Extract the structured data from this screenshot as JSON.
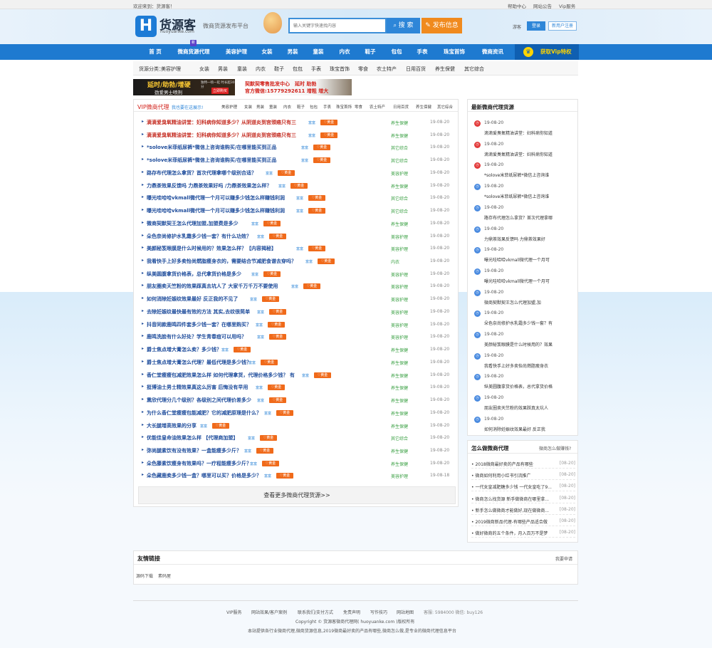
{
  "topbar": {
    "welcome": "欢迎来到：货源客！",
    "help": "帮助中心",
    "announce": "网站公告",
    "vip": "Vip服务"
  },
  "header": {
    "logo_char": "H",
    "logo_name": "货源客",
    "logo_domain": "huoyuanke.com",
    "slogan": "微商货源发布平台",
    "search_placeholder": "输入关键字快速找内容",
    "search_btn": "搜 索",
    "publish_btn": "发布信息",
    "guest": "游客",
    "login": "登录",
    "register": "新用户注册"
  },
  "nav": {
    "items": [
      "首 页",
      "微商货源代理",
      "美容护理",
      "女装",
      "男装",
      "童装",
      "内衣",
      "鞋子",
      "包包",
      "手表",
      "珠宝首饰",
      "微商资讯"
    ],
    "new_badge": "新",
    "vip": "获取Vip特权"
  },
  "categories": {
    "label": "货源分类：",
    "items": [
      "美容护理",
      "女装",
      "男装",
      "童装",
      "内衣",
      "鞋子",
      "包包",
      "手表",
      "珠宝首饰",
      "零食",
      "农土特产",
      "日用百货",
      "养生保健",
      "其它综合"
    ]
  },
  "ads": {
    "ad1_title": "延时/助勃/增硬",
    "ad1_sub": "劲爱男士喷剂",
    "ad1_note": "独特一喷一延 时长超30分",
    "ad1_btn": "立即购买",
    "ad2_line1": "契默契零售批发中心　延时 助勃",
    "ad2_line2": "官方微信:15779292611 增粗 增大"
  },
  "main": {
    "title": "VIP微商代理",
    "subtitle": "我也要在这展示!",
    "tabs": [
      "美容护理",
      "女装",
      "男装",
      "童装",
      "内衣",
      "鞋子",
      "包包",
      "手表",
      "珠宝首饰",
      "零食",
      "农土特产",
      "日用百货",
      "养生保健",
      "其它综合"
    ],
    "badge_text": "富富",
    "vip_text": "黄金",
    "rows": [
      {
        "title": "滴滴爱臭氧精油讲堂：妇科病你知道多少？从阴道炎到宫颈癌只有三",
        "red": true,
        "cat": "养生保健",
        "date": "19-08-20"
      },
      {
        "title": "滴滴爱臭氧精油讲堂：妇科病你知道多少？从阴道炎到宫颈癌只有三",
        "red": true,
        "cat": "养生保健",
        "date": "19-08-20"
      },
      {
        "title": "*solove米菲纸尿裤*微信上咨询谁购买/在哪里能买到正品",
        "red": false,
        "cat": "其它综合",
        "date": "19-08-20"
      },
      {
        "title": "*solove米菲纸尿裤*微信上咨询谁购买/在哪里能买到正品",
        "red": false,
        "cat": "其它综合",
        "date": "19-08-20"
      },
      {
        "title": "路存布代理怎么拿货？首次代理拿哪个级别合适？",
        "red": false,
        "cat": "美容护理",
        "date": "19-08-20"
      },
      {
        "title": "力鼎茶效果反馈吗 力鼎茶效果好吗 /力鼎茶效果怎么样？",
        "red": false,
        "cat": "养生保健",
        "date": "19-08-20"
      },
      {
        "title": "曝光哇哈哈vkmall微代理一个月可以赚多少钱怎么样赚钱利润",
        "red": false,
        "cat": "其它综合",
        "date": "19-08-20"
      },
      {
        "title": "曝光哇哈哈vkmall微代理一个月可以赚多少钱怎么样赚钱利润",
        "red": false,
        "cat": "其它综合",
        "date": "19-08-20"
      },
      {
        "title": "微商契默契王怎么代理加盟,加盟费是多少",
        "red": false,
        "cat": "养生保健",
        "date": "19-08-20"
      },
      {
        "title": "朵色奈尚修护水乳霜多少钱一套？有什么功效？",
        "red": false,
        "cat": "美容护理",
        "date": "19-08-20"
      },
      {
        "title": "美颜秘笈眼膜是什么时候用的？效果怎么样？【内容揭秘】",
        "red": false,
        "cat": "美容护理",
        "date": "19-08-20"
      },
      {
        "title": "我看快手上好多卖怡尚燃脂瘦身衣的，需要结合节减肥食谱去穿吗？",
        "red": false,
        "cat": "内衣",
        "date": "19-08-20"
      },
      {
        "title": "纵美圆腹拿货价格表，总代拿货价格是多少",
        "red": false,
        "cat": "美容护理",
        "date": "19-08-20"
      },
      {
        "title": "朋友圈卖天竺粉的效果踩真去坑人了 大家千万千万不要使用",
        "red": false,
        "cat": "美容护理",
        "date": "19-08-20"
      },
      {
        "title": "如何消除妊娠纹效果最好 反正我的不见了",
        "red": false,
        "cat": "美容护理",
        "date": "19-08-20"
      },
      {
        "title": "去除妊娠纹最快最有效的方法 其实,去纹很简单",
        "red": false,
        "cat": "美容护理",
        "date": "19-08-20"
      },
      {
        "title": "抖音同款鹿鸣四件套多少钱一套？在哪里购买？",
        "red": false,
        "cat": "美容护理",
        "date": "19-08-20"
      },
      {
        "title": "鹿鸣洗脸有什么好处？学生青春痘可以用吗？",
        "red": false,
        "cat": "美容护理",
        "date": "19-08-20"
      },
      {
        "title": "爵士焦点增大膏怎么卖？多少钱？",
        "red": false,
        "cat": "养生保健",
        "date": "19-08-20"
      },
      {
        "title": "爵士焦点增大膏怎么代理？最低代理是多少钱？",
        "red": false,
        "cat": "养生保健",
        "date": "19-08-20"
      },
      {
        "title": "香仁堂瘦瘦包减肥效果怎么样 如何代理拿货，代理价格多少钱？ 有",
        "red": false,
        "cat": "养生保健",
        "date": "19-08-20"
      },
      {
        "title": "挺博油士男士精效果真这么厉害 后悔没有早用",
        "red": false,
        "cat": "养生保健",
        "date": "19-08-20"
      },
      {
        "title": "熏欣代理分几个级别？各级别之间代理价差多少",
        "red": false,
        "cat": "养生保健",
        "date": "19-08-20"
      },
      {
        "title": "为什么香仁堂瘦瘦包能减肥？它的减肥原理是什么？",
        "red": false,
        "cat": "养生保健",
        "date": "19-08-20"
      },
      {
        "title": "大长腿增高效果的分享",
        "red": false,
        "cat": "养生保健",
        "date": "19-08-20"
      },
      {
        "title": "优能佳皇命油效果怎么样 【代理商加盟】",
        "red": false,
        "cat": "其它综合",
        "date": "19-08-20"
      },
      {
        "title": "弥尚腿素饮有没有效果？一盒能瘦多少斤？",
        "red": false,
        "cat": "养生保健",
        "date": "19-08-20"
      },
      {
        "title": "朵色藤素饮瘦身有效果吗？一疗程能瘦多少斤？",
        "red": false,
        "cat": "养生保健",
        "date": "19-08-20"
      },
      {
        "title": "朵色藏鹿卖多少钱一盒？哪里可以买？价格是多少？",
        "red": false,
        "cat": "美容护理",
        "date": "19-08-18"
      }
    ],
    "more": "查看更多微商代理货源>>"
  },
  "side1": {
    "title": "最新微商代理货源",
    "items": [
      {
        "date": "19-08-20",
        "text": "滴滴爱臭氧精油讲堂：妇科病你知道",
        "num": "1",
        "color": "#e33b3b"
      },
      {
        "date": "19-08-20",
        "text": "滴滴爱臭氧精油讲堂：妇科病你知道",
        "num": "2",
        "color": "#e33b3b"
      },
      {
        "date": "19-08-20",
        "text": "*solove米菲纸尿裤*微信上咨询谁",
        "num": "3",
        "color": "#e33b3b"
      },
      {
        "date": "19-08-20",
        "text": "*solove米菲纸尿裤*微信上咨询谁",
        "num": "4",
        "color": "#4a8be0"
      },
      {
        "date": "19-08-20",
        "text": "路存布代理怎么拿货？首次代理拿哪",
        "num": "5",
        "color": "#4a8be0"
      },
      {
        "date": "19-08-20",
        "text": "力鼎茶效果反馈吗 力鼎茶效果好",
        "num": "6",
        "color": "#4a8be0"
      },
      {
        "date": "19-08-20",
        "text": "曝光哇哈哈vkmall微代理一个月可",
        "num": "7",
        "color": "#4a8be0"
      },
      {
        "date": "19-08-20",
        "text": "曝光哇哈哈vkmall微代理一个月可",
        "num": "8",
        "color": "#4a8be0"
      },
      {
        "date": "19-08-20",
        "text": "微商契默契王怎么代理加盟,加",
        "num": "9",
        "color": "#4a8be0"
      },
      {
        "date": "19-08-20",
        "text": "朵色奈尚修护水乳霜多少钱一套？有",
        "num": "10",
        "color": "#4a8be0"
      },
      {
        "date": "19-08-20",
        "text": "美颜秘笈眼膜是什么时候用的？效果",
        "num": "11",
        "color": "#4a8be0"
      },
      {
        "date": "19-08-20",
        "text": "我看快手上好多卖怡尚燃脂瘦身衣",
        "num": "12",
        "color": "#4a8be0"
      },
      {
        "date": "19-08-20",
        "text": "纵美圆腹拿货价格表，总代拿货价格",
        "num": "13",
        "color": "#4a8be0"
      },
      {
        "date": "19-08-20",
        "text": "朋友圈卖天竺粉的效果踩真太坑人",
        "num": "14",
        "color": "#4a8be0"
      },
      {
        "date": "19-08-20",
        "text": "如何消除妊娠纹效果最好 反正我",
        "num": "15",
        "color": "#4a8be0"
      }
    ]
  },
  "side2": {
    "title": "怎么做微商代理",
    "link": "微商怎么做赚钱?",
    "items": [
      {
        "text": "2018微商最好卖的产品有哪些",
        "date": "[08-20]"
      },
      {
        "text": "微商如何利用小红书引流推广",
        "date": "[08-20]"
      },
      {
        "text": "一代女皇减肥糖多少钱 一代女皇吃了9...",
        "date": "[08-20]"
      },
      {
        "text": "微商怎么找货源 新手做微商在哪里拿...",
        "date": "[08-20]"
      },
      {
        "text": "新手怎么做微商才能做好,现在做微商...",
        "date": "[08-20]"
      },
      {
        "text": "2019微商新品代理-有哪些产品适合做",
        "date": "[08-20]"
      },
      {
        "text": "做好微商的五个条件，月入百万不是梦",
        "date": "[08-20]"
      }
    ]
  },
  "links": {
    "title": "友情链接",
    "apply": "我要申请",
    "items": [
      "源码下载",
      "素码屋"
    ]
  },
  "footer": {
    "links": [
      "VIP服务",
      "网站效果/客户案例",
      "联系我们/支付方式",
      "免责声明",
      "写作技巧",
      "网站地图"
    ],
    "stats": "客服: 5984000 微信: buy126",
    "copyright": "Copyright © 货源客微商代理网( huoyuanke.com )版权所有",
    "desc": "本站提供各行业微商代理,微商货源信息,2019微商最好卖的产品有哪些,微商怎么做,是专业的微商代理信息平台"
  },
  "colors": {
    "nav": "#1e7ad0",
    "accent": "#2e86d8",
    "orange": "#f08a1e",
    "red": "#c42a1f",
    "link": "#1f4d9c",
    "green": "#3aa043"
  }
}
